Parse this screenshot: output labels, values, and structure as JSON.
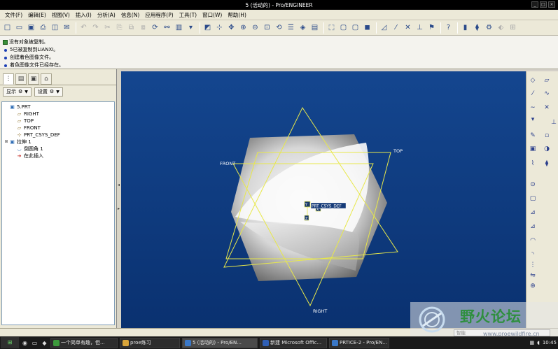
{
  "window": {
    "title": "5 (活动的) - Pro/ENGINEER",
    "buttons": [
      "_",
      "□",
      "×"
    ]
  },
  "menu": [
    "文件(F)",
    "编辑(E)",
    "视图(V)",
    "插入(I)",
    "分析(A)",
    "信息(N)",
    "应用程序(P)",
    "工具(T)",
    "窗口(W)",
    "帮助(H)"
  ],
  "toolbar_icons": [
    {
      "name": "new-icon",
      "glyph": "□",
      "dim": false
    },
    {
      "name": "open-icon",
      "glyph": "▭",
      "dim": false
    },
    {
      "name": "save-icon",
      "glyph": "▣",
      "dim": false
    },
    {
      "name": "print-icon",
      "glyph": "⎙",
      "dim": false
    },
    {
      "name": "print-preview-icon",
      "glyph": "◫",
      "dim": false
    },
    {
      "name": "email-icon",
      "glyph": "✉",
      "dim": false
    },
    {
      "name": "sep"
    },
    {
      "name": "undo-icon",
      "glyph": "↶",
      "dim": true
    },
    {
      "name": "redo-icon",
      "glyph": "↷",
      "dim": true
    },
    {
      "name": "cut-icon",
      "glyph": "✂",
      "dim": true
    },
    {
      "name": "copy-icon",
      "glyph": "⎘",
      "dim": true
    },
    {
      "name": "paste-icon",
      "glyph": "⧉",
      "dim": true
    },
    {
      "name": "paste-special-icon",
      "glyph": "⧈",
      "dim": true
    },
    {
      "name": "regenerate-icon",
      "glyph": "⟳",
      "dim": false
    },
    {
      "name": "find-icon",
      "glyph": "⚯",
      "dim": false
    },
    {
      "name": "select-filter-icon",
      "glyph": "▥",
      "dim": false
    },
    {
      "name": "dropdown-icon",
      "glyph": "▾",
      "dim": false
    },
    {
      "name": "sep"
    },
    {
      "name": "repaint-icon",
      "glyph": "◩",
      "dim": false
    },
    {
      "name": "spin-center-icon",
      "glyph": "⊹",
      "dim": false
    },
    {
      "name": "orient-mode-icon",
      "glyph": "✥",
      "dim": false
    },
    {
      "name": "zoom-in-icon",
      "glyph": "⊕",
      "dim": false
    },
    {
      "name": "zoom-out-icon",
      "glyph": "⊖",
      "dim": false
    },
    {
      "name": "refit-icon",
      "glyph": "⊡",
      "dim": false
    },
    {
      "name": "reorient-icon",
      "glyph": "⟲",
      "dim": false
    },
    {
      "name": "saved-views-icon",
      "glyph": "☰",
      "dim": false
    },
    {
      "name": "layers-icon",
      "glyph": "◈",
      "dim": false
    },
    {
      "name": "view-manager-icon",
      "glyph": "▤",
      "dim": false
    },
    {
      "name": "sep"
    },
    {
      "name": "wireframe-icon",
      "glyph": "⬚",
      "dim": false
    },
    {
      "name": "hidden-line-icon",
      "glyph": "▢",
      "dim": false
    },
    {
      "name": "no-hidden-icon",
      "glyph": "▢",
      "dim": false
    },
    {
      "name": "shading-icon",
      "glyph": "◼",
      "dim": false
    },
    {
      "name": "sep"
    },
    {
      "name": "datum-planes-icon",
      "glyph": "◿",
      "dim": false
    },
    {
      "name": "datum-axes-icon",
      "glyph": "⁄",
      "dim": false
    },
    {
      "name": "datum-points-icon",
      "glyph": "✕",
      "dim": false
    },
    {
      "name": "csys-icon",
      "glyph": "⊥",
      "dim": false
    },
    {
      "name": "annotations-icon",
      "glyph": "⚑",
      "dim": false
    },
    {
      "name": "sep"
    },
    {
      "name": "context-help-icon",
      "glyph": "?",
      "dim": false
    },
    {
      "name": "sep"
    },
    {
      "name": "feature-icon-1",
      "glyph": "▮",
      "dim": false
    },
    {
      "name": "feature-icon-2",
      "glyph": "⧫",
      "dim": false
    },
    {
      "name": "feature-icon-3",
      "glyph": "⚙",
      "dim": false
    },
    {
      "name": "feature-icon-4",
      "glyph": "⬖",
      "dim": true
    },
    {
      "name": "feature-icon-5",
      "glyph": "⊞",
      "dim": true
    }
  ],
  "messages": [
    {
      "kind": "square",
      "text": "没有对象被复制。"
    },
    {
      "kind": "bullet",
      "text": "5已被复制到LIANXI。"
    },
    {
      "kind": "bullet",
      "text": "创建着色图像文件。"
    },
    {
      "kind": "bullet",
      "text": "着色图像文件已经存在。"
    }
  ],
  "navigator": {
    "tabs": [
      "model-tree-tab-icon",
      "folder-browser-tab-icon",
      "favorites-tab-icon",
      "history-tab-icon"
    ],
    "show_menu": "显示",
    "settings_menu": "设置",
    "tree": [
      {
        "label": "5.PRT",
        "icon": "▣",
        "color": "#2f6db5",
        "indent": 0,
        "expander": ""
      },
      {
        "label": "RIGHT",
        "icon": "▱",
        "color": "#8a6a1f",
        "indent": 1,
        "expander": ""
      },
      {
        "label": "TOP",
        "icon": "▱",
        "color": "#8a6a1f",
        "indent": 1,
        "expander": ""
      },
      {
        "label": "FRONT",
        "icon": "▱",
        "color": "#8a6a1f",
        "indent": 1,
        "expander": ""
      },
      {
        "label": "PRT_CSYS_DEF",
        "icon": "⊹",
        "color": "#8a6a1f",
        "indent": 1,
        "expander": ""
      },
      {
        "label": "拉伸 1",
        "icon": "▣",
        "color": "#2f6db5",
        "indent": 0,
        "expander": "⊞"
      },
      {
        "label": "倒圆角 1",
        "icon": "◡",
        "color": "#2f6db5",
        "indent": 1,
        "expander": ""
      },
      {
        "label": "在此插入",
        "icon": "➔",
        "color": "#c0201a",
        "indent": 1,
        "expander": ""
      }
    ]
  },
  "viewport": {
    "plane_labels": {
      "front": "FRONT",
      "top": "TOP",
      "right": "RIGHT"
    },
    "csys_label": "PRT_CSYS_DEF",
    "csys_axes": {
      "x": "X",
      "y": "Y",
      "z": "Z"
    },
    "background": "#0f3d84",
    "datum_color": "#e8e84a"
  },
  "right_toolbar": [
    "datum-plane-icon",
    "datum-plane-offset-icon",
    "datum-axis-icon",
    "datum-curve-icon",
    "sketched-curve-icon",
    "datum-point-icon",
    "datum-point-dropdown-icon",
    "csys-create-icon",
    "analysis-icon",
    "sketch-tool-icon",
    "extrude-icon",
    "revolve-icon",
    "variable-sweep-icon",
    "blend-icon",
    "hole-icon",
    "shell-icon",
    "rib-icon",
    "draft-icon",
    "round-icon",
    "chamfer-icon",
    "pattern-icon",
    "mirror-icon",
    "merge-icon"
  ],
  "status": {
    "smart_filter": "智能"
  },
  "watermark": {
    "text": "野火论坛",
    "url": "www.proewildfire.cn"
  },
  "taskbar": {
    "start": "⊞",
    "items": [
      {
        "label": "一个简单有趣，但...",
        "color": "#3c9a3c",
        "active": false
      },
      {
        "label": "proe练习",
        "color": "#d9a53a",
        "active": false
      },
      {
        "label": "5 (活动的) - Pro/EN...",
        "color": "#3a78c8",
        "active": true
      },
      {
        "label": "新建 Microsoft Offic...",
        "color": "#2f5fb5",
        "active": false
      },
      {
        "label": "PRTICE-2 - Pro/EN...",
        "color": "#3a78c8",
        "active": false
      }
    ],
    "clock": "10:45"
  }
}
